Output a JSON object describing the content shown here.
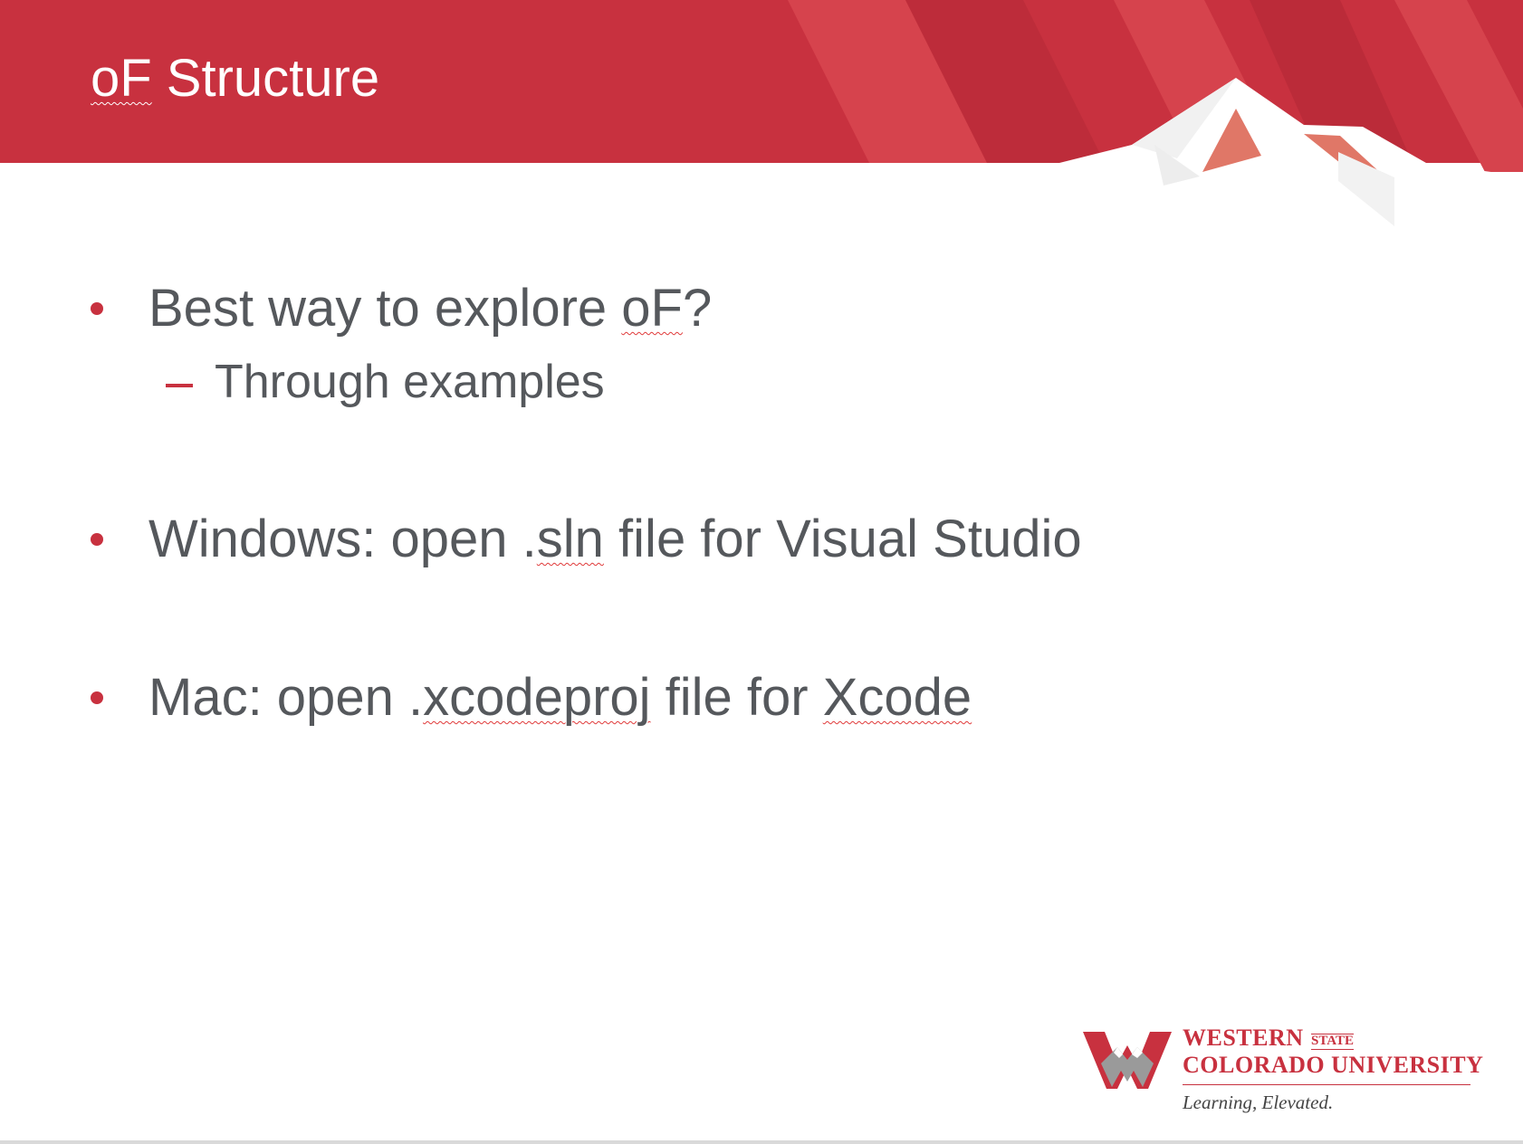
{
  "slide": {
    "title_prefix": "oF",
    "title_suffix": " Structure",
    "bullets": [
      {
        "parts": [
          "Best way to explore ",
          "oF",
          "?"
        ],
        "sub": [
          {
            "text": "Through examples"
          }
        ]
      },
      {
        "parts": [
          "Windows: open .",
          "sln",
          " file for Visual Studio"
        ]
      },
      {
        "parts": [
          "Mac: open .",
          "xcodeproj",
          " file for ",
          "Xcode"
        ]
      }
    ]
  },
  "logo": {
    "line1": "WESTERN",
    "state": "STATE",
    "line2": "COLORADO UNIVERSITY",
    "tagline": "Learning, Elevated."
  },
  "colors": {
    "banner_red": "#c8313f",
    "banner_red_dark": "#b92a38",
    "banner_red_light": "#d6434d",
    "bullet_red": "#c8313f",
    "body_text": "#55585c"
  }
}
